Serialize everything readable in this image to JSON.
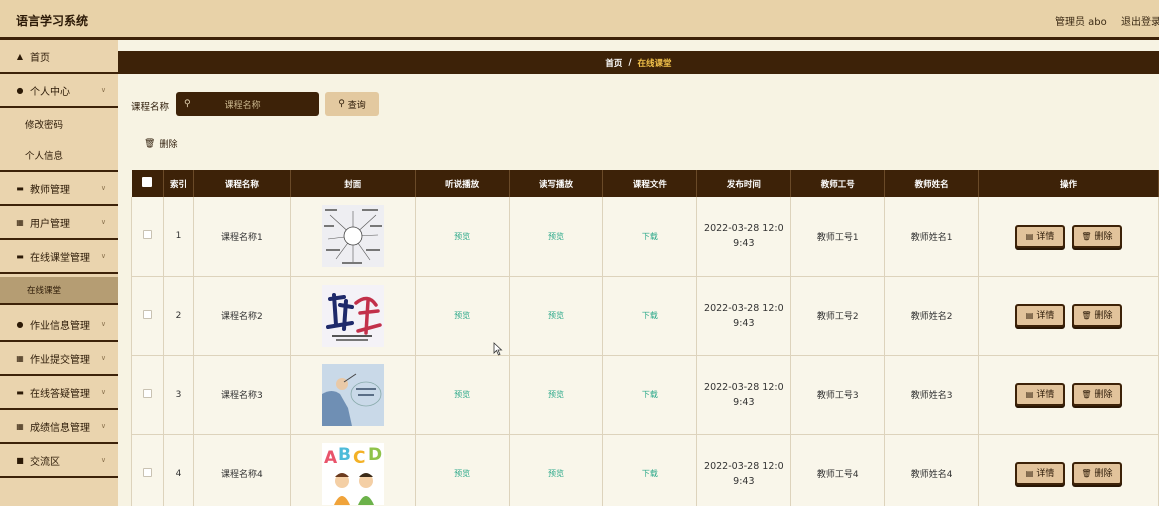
{
  "header": {
    "app_title": "语言学习系统",
    "admin": "管理员 abo",
    "logout": "退出登录"
  },
  "sidebar": {
    "items": [
      {
        "label": "首页",
        "icon": "home-icon"
      },
      {
        "label": "个人中心",
        "icon": "user-icon"
      },
      {
        "label": "修改密码"
      },
      {
        "label": "个人信息"
      },
      {
        "label": "教师管理",
        "icon": "teacher-icon"
      },
      {
        "label": "用户管理",
        "icon": "grid-icon"
      },
      {
        "label": "在线课堂管理",
        "icon": "book-icon"
      },
      {
        "label": "在线课堂"
      },
      {
        "label": "作业信息管理",
        "icon": "pin-icon"
      },
      {
        "label": "作业提交管理",
        "icon": "grid-icon"
      },
      {
        "label": "在线答疑管理",
        "icon": "chat-icon"
      },
      {
        "label": "成绩信息管理",
        "icon": "grid-icon"
      },
      {
        "label": "交流区",
        "icon": "forum-icon"
      }
    ]
  },
  "breadcrumb": {
    "home": "首页",
    "sep": "/",
    "current": "在线课堂"
  },
  "search": {
    "label": "课程名称",
    "placeholder": "课程名称",
    "button": "查询"
  },
  "delete_label": "删除",
  "table": {
    "headers": [
      "索引",
      "课程名称",
      "封面",
      "听说播放",
      "读写播放",
      "课程文件",
      "发布时间",
      "教师工号",
      "教师姓名",
      "操作"
    ],
    "preview_label": "预览",
    "download_label": "下载",
    "detail_btn": "详情",
    "delete_btn": "删除",
    "rows": [
      {
        "index": "1",
        "name": "课程名称1",
        "time": "2022-03-28 12:09:43",
        "teacher_id": "教师工号1",
        "teacher_name": "教师姓名1",
        "cover": "word-cloud"
      },
      {
        "index": "2",
        "name": "课程名称2",
        "time": "2022-03-28 12:09:43",
        "teacher_id": "教师工号2",
        "teacher_name": "教师姓名2",
        "cover": "calligraphy"
      },
      {
        "index": "3",
        "name": "课程名称3",
        "time": "2022-03-28 12:09:43",
        "teacher_id": "教师工号3",
        "teacher_name": "教师姓名3",
        "cover": "business-training"
      },
      {
        "index": "4",
        "name": "课程名称4",
        "time": "2022-03-28 12:09:43",
        "teacher_id": "教师工号4",
        "teacher_name": "教师姓名4",
        "cover": "abcd-kids"
      }
    ]
  },
  "colors": {
    "dark": "#3d2208",
    "tan": "#e8d2a8",
    "link": "#2aa889"
  }
}
